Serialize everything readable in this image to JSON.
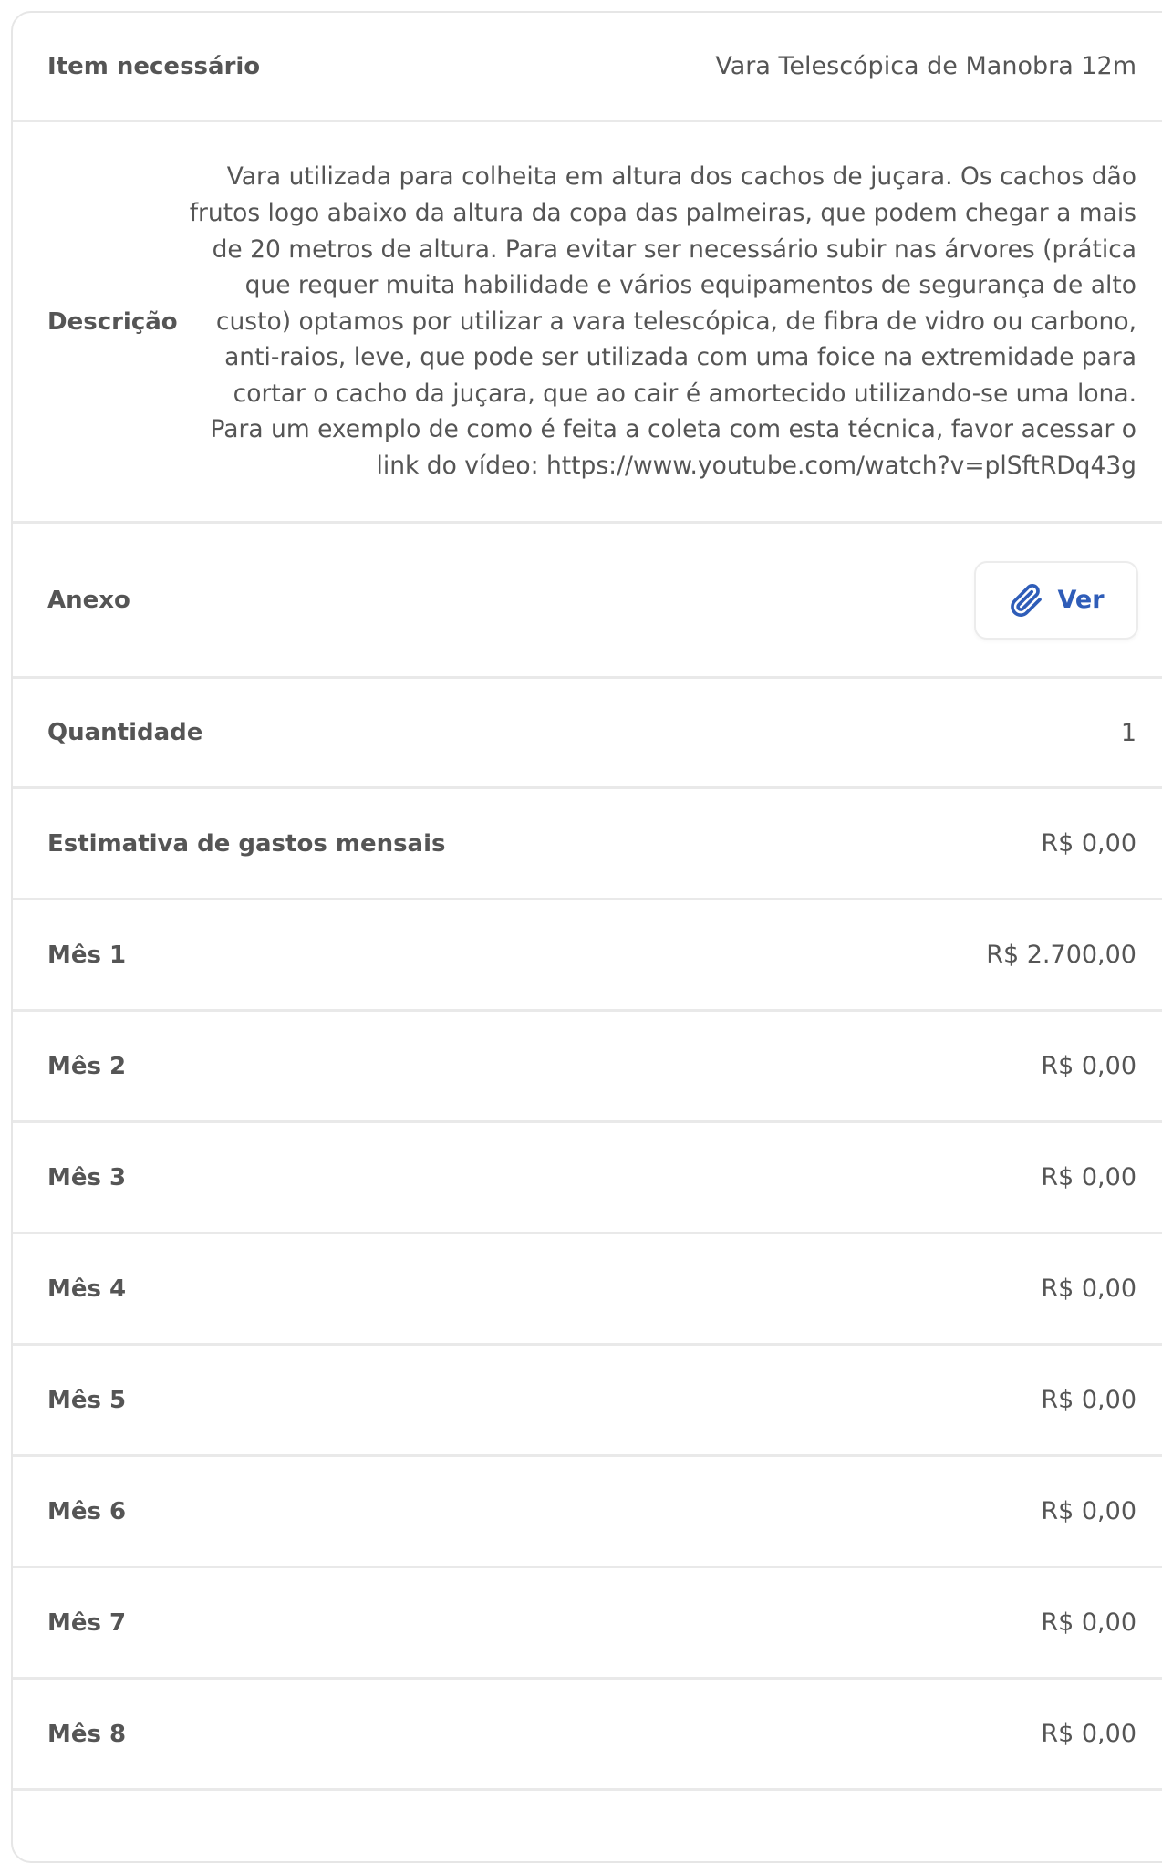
{
  "rows": {
    "item": {
      "label": "Item necessário",
      "value": "Vara Telescópica de Manobra 12m"
    },
    "descricao": {
      "label": "Descrição",
      "value": "Vara utilizada para colheita em altura dos cachos de juçara. Os cachos dão frutos logo abaixo da altura da copa das palmeiras, que podem chegar a mais de 20 metros de altura. Para evitar ser necessário subir nas árvores (prática que requer muita habilidade e vários equipamentos de segurança de alto custo) optamos por utilizar a vara telescópica, de fibra de vidro ou carbono, anti-raios, leve, que pode ser utilizada com uma foice na extremidade para cortar o cacho da juçara, que ao cair é amortecido utilizando-se uma lona. Para um exemplo de como é feita a coleta com esta técnica, favor acessar o link do vídeo: https://www.youtube.com/watch?v=plSftRDq43g"
    },
    "anexo": {
      "label": "Anexo",
      "button_label": "Ver",
      "button_icon": "paperclip-icon"
    },
    "quantidade": {
      "label": "Quantidade",
      "value": "1"
    },
    "estimativa": {
      "label": "Estimativa de gastos mensais",
      "value": "R$ 0,00"
    },
    "meses": [
      {
        "label": "Mês 1",
        "value": "R$ 2.700,00"
      },
      {
        "label": "Mês 2",
        "value": "R$ 0,00"
      },
      {
        "label": "Mês 3",
        "value": "R$ 0,00"
      },
      {
        "label": "Mês 4",
        "value": "R$ 0,00"
      },
      {
        "label": "Mês 5",
        "value": "R$ 0,00"
      },
      {
        "label": "Mês 6",
        "value": "R$ 0,00"
      },
      {
        "label": "Mês 7",
        "value": "R$ 0,00"
      },
      {
        "label": "Mês 8",
        "value": "R$ 0,00"
      }
    ]
  },
  "colors": {
    "text": "#555555",
    "accent": "#2f5db8",
    "divider": "#e9e9e9",
    "border": "#e6e6e6"
  }
}
